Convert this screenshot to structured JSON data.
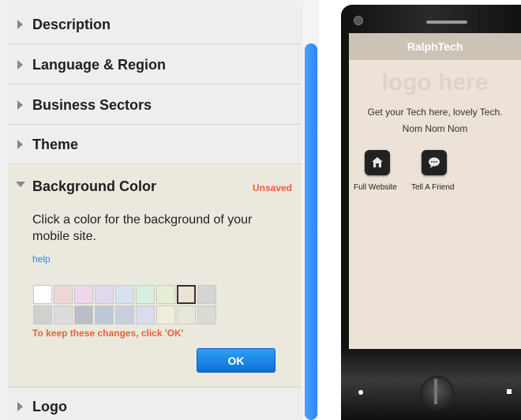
{
  "panel": {
    "sections": [
      {
        "label": "Description"
      },
      {
        "label": "Language & Region"
      },
      {
        "label": "Business Sectors"
      },
      {
        "label": "Theme"
      },
      {
        "label": "Logo"
      }
    ],
    "background": {
      "title": "Background Color",
      "status": "Unsaved",
      "instruction": "Click a color for the background of your mobile site.",
      "help": "help",
      "keep_message": "To keep these changes, click 'OK'",
      "ok_label": "OK",
      "selected_color": "#ebe2d6",
      "swatch_rows": [
        [
          "#ffffff",
          "#efd6d6",
          "#efd6ea",
          "#e1d7ef",
          "#d6e2ef",
          "#d6efdf",
          "#e6efd4",
          "#ebe2d6",
          "#d4d4d4"
        ],
        [
          "#d0d0d0",
          "#dcdcdc",
          "#b9bec8",
          "#bec8d6",
          "#c9cde0",
          "#dadbef",
          "#efeedc",
          "#e7e7d9",
          "#dadbd6"
        ]
      ]
    }
  },
  "phone": {
    "header_title": "RalphTech",
    "logo_text": "logo here",
    "tagline": "Get your Tech here, lovely Tech. Nom Nom Nom",
    "icons": [
      {
        "label": "Full Website",
        "icon": "home-icon"
      },
      {
        "label": "Tell A Friend",
        "icon": "chat-bubble-icon"
      }
    ]
  },
  "colors": {
    "accent_blue": "#1a84e8",
    "unsaved_orange": "#e8603c",
    "screen_bg": "#ece2d8"
  }
}
